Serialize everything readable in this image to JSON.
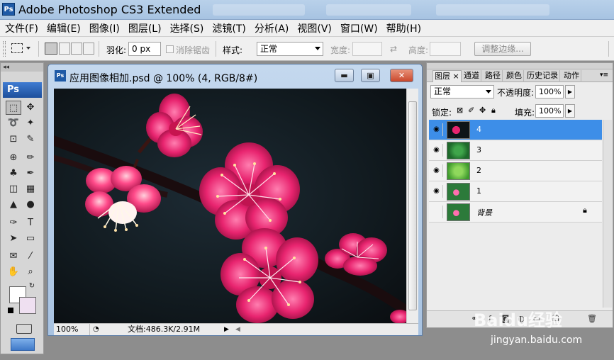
{
  "app": {
    "title": "Adobe Photoshop CS3 Extended",
    "logo": "Ps"
  },
  "menu": [
    "文件(F)",
    "编辑(E)",
    "图像(I)",
    "图层(L)",
    "选择(S)",
    "滤镜(T)",
    "分析(A)",
    "视图(V)",
    "窗口(W)",
    "帮助(H)"
  ],
  "options": {
    "feather_label": "羽化:",
    "feather_value": "0 px",
    "antialias_label": "消除锯齿",
    "style_label": "样式:",
    "style_value": "正常",
    "width_label": "宽度:",
    "height_label": "高度:",
    "refine_edge": "调整边缘..."
  },
  "toolbox": {
    "collapse": "◂◂",
    "logo": "Ps"
  },
  "document": {
    "title": "应用图像相加.psd @ 100% (4, RGB/8#)",
    "zoom": "100%",
    "doc_info": "文档:486.3K/2.91M",
    "minimize": "▬",
    "maximize": "▣",
    "close": "✕"
  },
  "layers_panel": {
    "tabs": [
      "图层",
      "通道",
      "路径",
      "颜色",
      "历史记录",
      "动作"
    ],
    "tab_close": "×",
    "blend_mode": "正常",
    "opacity_label": "不透明度:",
    "opacity_value": "100%",
    "lock_label": "锁定:",
    "fill_label": "填充:",
    "fill_value": "100%",
    "layers": [
      {
        "name": "4",
        "selected": true,
        "visible": true
      },
      {
        "name": "3",
        "selected": false,
        "visible": true
      },
      {
        "name": "2",
        "selected": false,
        "visible": true
      },
      {
        "name": "1",
        "selected": false,
        "visible": true
      },
      {
        "name": "背景",
        "selected": false,
        "visible": false,
        "locked": true
      }
    ]
  },
  "watermark": {
    "brand": "Baidu经验",
    "url": "jingyan.baidu.com"
  },
  "colors": {
    "selected_layer": "#3d8ee8",
    "title_bar": "#b9d1ea",
    "flower_pink": "#e8246f"
  }
}
